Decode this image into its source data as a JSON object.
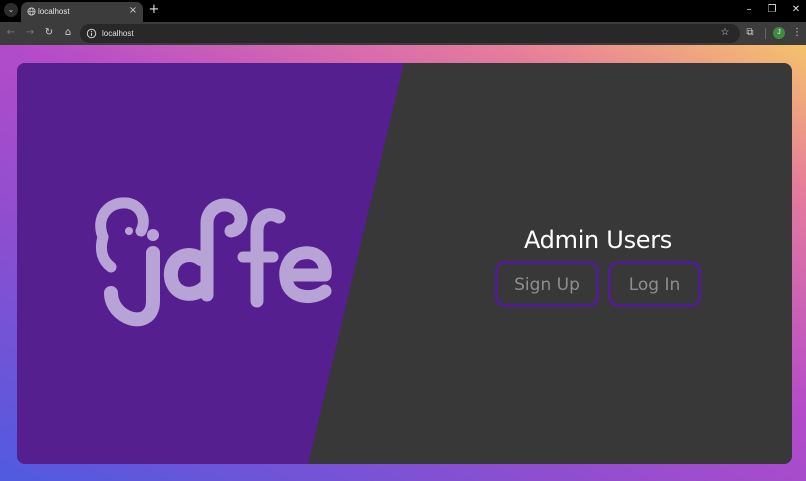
{
  "browser": {
    "tab": {
      "title": "localhost",
      "favicon": "globe-icon",
      "close_icon": "×"
    },
    "tab_menu_icon": "⌄",
    "new_tab_icon": "+",
    "window_controls": {
      "minimize": "–",
      "restore": "❐",
      "close": "✕"
    },
    "toolbar": {
      "back_icon": "←",
      "forward_icon": "→",
      "reload_icon": "↻",
      "home_icon": "⌂",
      "url": "localhost",
      "star_icon": "☆",
      "extensions_icon": "⧉",
      "profile_initial": "J",
      "menu_icon": "⋮"
    }
  },
  "page": {
    "logo_text": "jdfe",
    "auth": {
      "title": "Admin Users",
      "signup_label": "Sign Up",
      "login_label": "Log In"
    },
    "colors": {
      "left_panel": "#561f8f",
      "right_panel": "#383838",
      "logo": "#b8a3d6",
      "button_border": "#4f1f8f",
      "button_text": "#8e8e8e"
    }
  }
}
